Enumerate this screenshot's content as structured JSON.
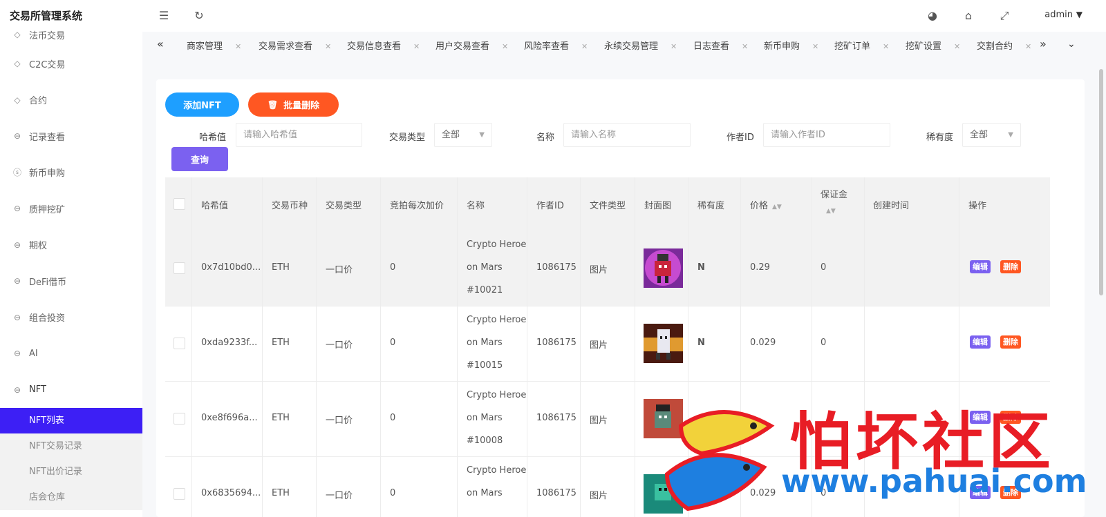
{
  "app": {
    "title": "交易所管理系统"
  },
  "header": {
    "user": "admin"
  },
  "sidebar": {
    "items": [
      {
        "label": "法币交易",
        "icon": "diamond-icon"
      },
      {
        "label": "C2C交易",
        "icon": "diamond-icon"
      },
      {
        "label": "合约",
        "icon": "diamond-icon"
      },
      {
        "label": "记录查看",
        "icon": "circle-arrow-icon"
      },
      {
        "label": "新币申购",
        "icon": "dollar-icon"
      },
      {
        "label": "质押挖矿",
        "icon": "circle-arrow-icon"
      },
      {
        "label": "期权",
        "icon": "circle-arrow-icon"
      },
      {
        "label": "DeFi借币",
        "icon": "circle-arrow-icon"
      },
      {
        "label": "组合投资",
        "icon": "circle-arrow-icon"
      },
      {
        "label": "AI",
        "icon": "circle-arrow-icon"
      },
      {
        "label": "NFT",
        "icon": "circle-arrow-icon"
      }
    ],
    "submenu": [
      {
        "label": "NFT列表"
      },
      {
        "label": "NFT交易记录"
      },
      {
        "label": "NFT出价记录"
      },
      {
        "label": "店会仓库"
      }
    ]
  },
  "tabs": [
    {
      "label": "商家管理"
    },
    {
      "label": "交易需求查看"
    },
    {
      "label": "交易信息查看"
    },
    {
      "label": "用户交易查看"
    },
    {
      "label": "风险率查看"
    },
    {
      "label": "永续交易管理"
    },
    {
      "label": "日志查看"
    },
    {
      "label": "新币申购"
    },
    {
      "label": "挖矿订单"
    },
    {
      "label": "挖矿设置"
    },
    {
      "label": "交割合约"
    }
  ],
  "toolbar": {
    "add_label": "添加NFT",
    "batch_delete_label": "批量删除",
    "query_label": "查询"
  },
  "filters": {
    "hash": {
      "label": "哈希值",
      "placeholder": "请输入哈希值"
    },
    "trade_type": {
      "label": "交易类型",
      "value": "全部"
    },
    "name": {
      "label": "名称",
      "placeholder": "请输入名称"
    },
    "author": {
      "label": "作者ID",
      "placeholder": "请输入作者ID"
    },
    "rarity": {
      "label": "稀有度",
      "value": "全部"
    }
  },
  "table": {
    "headers": [
      "哈希值",
      "交易币种",
      "交易类型",
      "竞拍每次加价",
      "名称",
      "作者ID",
      "文件类型",
      "封面图",
      "稀有度",
      "价格",
      "保证金",
      "创建时间",
      "操作"
    ],
    "edit_label": "编辑",
    "delete_label": "删除",
    "rows": [
      {
        "hash": "0x7d10bd0...",
        "coin": "ETH",
        "type": "一口价",
        "increment": "0",
        "name1": "Crypto Heroe",
        "name2": "on Mars",
        "name3": "#10021",
        "author": "1086175",
        "file": "图片",
        "rarity": "N",
        "price": "0.29",
        "deposit": "0"
      },
      {
        "hash": "0xda9233f...",
        "coin": "ETH",
        "type": "一口价",
        "increment": "0",
        "name1": "Crypto Heroe",
        "name2": "on Mars",
        "name3": "#10015",
        "author": "1086175",
        "file": "图片",
        "rarity": "N",
        "price": "0.029",
        "deposit": "0"
      },
      {
        "hash": "0xe8f696a...",
        "coin": "ETH",
        "type": "一口价",
        "increment": "0",
        "name1": "Crypto Heroe",
        "name2": "on Mars",
        "name3": "#10008",
        "author": "1086175",
        "file": "图片",
        "rarity": "",
        "price": "",
        "deposit": ""
      },
      {
        "hash": "0x6835694...",
        "coin": "ETH",
        "type": "一口价",
        "increment": "0",
        "name1": "Crypto Heroe",
        "name2": "on Mars",
        "name3": "",
        "author": "1086175",
        "file": "图片",
        "rarity": "N",
        "price": "0.029",
        "deposit": "0"
      }
    ]
  },
  "watermark": {
    "text": "怕坏社区",
    "url": "www.pahuai.com"
  },
  "colors": {
    "primary": "#3d1ff5",
    "add": "#1e9fff",
    "danger": "#ff5722",
    "query": "#7b61f0",
    "watermark_red": "#e81d25",
    "watermark_blue": "#1e7fe0"
  }
}
